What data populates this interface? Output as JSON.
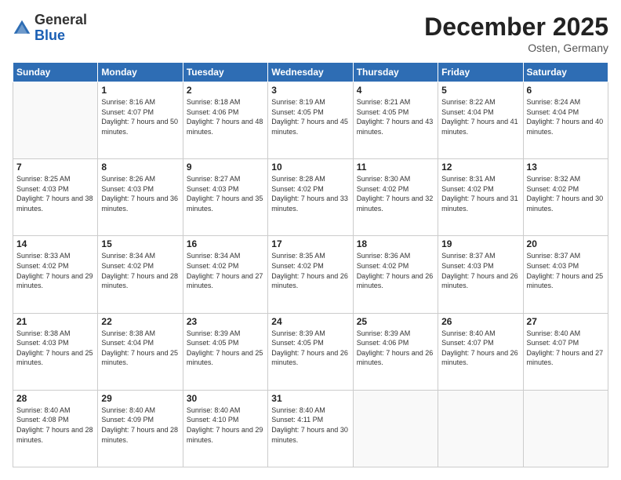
{
  "logo": {
    "general": "General",
    "blue": "Blue"
  },
  "title": "December 2025",
  "location": "Osten, Germany",
  "headers": [
    "Sunday",
    "Monday",
    "Tuesday",
    "Wednesday",
    "Thursday",
    "Friday",
    "Saturday"
  ],
  "weeks": [
    [
      {
        "day": "",
        "sunrise": "",
        "sunset": "",
        "daylight": ""
      },
      {
        "day": "1",
        "sunrise": "Sunrise: 8:16 AM",
        "sunset": "Sunset: 4:07 PM",
        "daylight": "Daylight: 7 hours and 50 minutes."
      },
      {
        "day": "2",
        "sunrise": "Sunrise: 8:18 AM",
        "sunset": "Sunset: 4:06 PM",
        "daylight": "Daylight: 7 hours and 48 minutes."
      },
      {
        "day": "3",
        "sunrise": "Sunrise: 8:19 AM",
        "sunset": "Sunset: 4:05 PM",
        "daylight": "Daylight: 7 hours and 45 minutes."
      },
      {
        "day": "4",
        "sunrise": "Sunrise: 8:21 AM",
        "sunset": "Sunset: 4:05 PM",
        "daylight": "Daylight: 7 hours and 43 minutes."
      },
      {
        "day": "5",
        "sunrise": "Sunrise: 8:22 AM",
        "sunset": "Sunset: 4:04 PM",
        "daylight": "Daylight: 7 hours and 41 minutes."
      },
      {
        "day": "6",
        "sunrise": "Sunrise: 8:24 AM",
        "sunset": "Sunset: 4:04 PM",
        "daylight": "Daylight: 7 hours and 40 minutes."
      }
    ],
    [
      {
        "day": "7",
        "sunrise": "Sunrise: 8:25 AM",
        "sunset": "Sunset: 4:03 PM",
        "daylight": "Daylight: 7 hours and 38 minutes."
      },
      {
        "day": "8",
        "sunrise": "Sunrise: 8:26 AM",
        "sunset": "Sunset: 4:03 PM",
        "daylight": "Daylight: 7 hours and 36 minutes."
      },
      {
        "day": "9",
        "sunrise": "Sunrise: 8:27 AM",
        "sunset": "Sunset: 4:03 PM",
        "daylight": "Daylight: 7 hours and 35 minutes."
      },
      {
        "day": "10",
        "sunrise": "Sunrise: 8:28 AM",
        "sunset": "Sunset: 4:02 PM",
        "daylight": "Daylight: 7 hours and 33 minutes."
      },
      {
        "day": "11",
        "sunrise": "Sunrise: 8:30 AM",
        "sunset": "Sunset: 4:02 PM",
        "daylight": "Daylight: 7 hours and 32 minutes."
      },
      {
        "day": "12",
        "sunrise": "Sunrise: 8:31 AM",
        "sunset": "Sunset: 4:02 PM",
        "daylight": "Daylight: 7 hours and 31 minutes."
      },
      {
        "day": "13",
        "sunrise": "Sunrise: 8:32 AM",
        "sunset": "Sunset: 4:02 PM",
        "daylight": "Daylight: 7 hours and 30 minutes."
      }
    ],
    [
      {
        "day": "14",
        "sunrise": "Sunrise: 8:33 AM",
        "sunset": "Sunset: 4:02 PM",
        "daylight": "Daylight: 7 hours and 29 minutes."
      },
      {
        "day": "15",
        "sunrise": "Sunrise: 8:34 AM",
        "sunset": "Sunset: 4:02 PM",
        "daylight": "Daylight: 7 hours and 28 minutes."
      },
      {
        "day": "16",
        "sunrise": "Sunrise: 8:34 AM",
        "sunset": "Sunset: 4:02 PM",
        "daylight": "Daylight: 7 hours and 27 minutes."
      },
      {
        "day": "17",
        "sunrise": "Sunrise: 8:35 AM",
        "sunset": "Sunset: 4:02 PM",
        "daylight": "Daylight: 7 hours and 26 minutes."
      },
      {
        "day": "18",
        "sunrise": "Sunrise: 8:36 AM",
        "sunset": "Sunset: 4:02 PM",
        "daylight": "Daylight: 7 hours and 26 minutes."
      },
      {
        "day": "19",
        "sunrise": "Sunrise: 8:37 AM",
        "sunset": "Sunset: 4:03 PM",
        "daylight": "Daylight: 7 hours and 26 minutes."
      },
      {
        "day": "20",
        "sunrise": "Sunrise: 8:37 AM",
        "sunset": "Sunset: 4:03 PM",
        "daylight": "Daylight: 7 hours and 25 minutes."
      }
    ],
    [
      {
        "day": "21",
        "sunrise": "Sunrise: 8:38 AM",
        "sunset": "Sunset: 4:03 PM",
        "daylight": "Daylight: 7 hours and 25 minutes."
      },
      {
        "day": "22",
        "sunrise": "Sunrise: 8:38 AM",
        "sunset": "Sunset: 4:04 PM",
        "daylight": "Daylight: 7 hours and 25 minutes."
      },
      {
        "day": "23",
        "sunrise": "Sunrise: 8:39 AM",
        "sunset": "Sunset: 4:05 PM",
        "daylight": "Daylight: 7 hours and 25 minutes."
      },
      {
        "day": "24",
        "sunrise": "Sunrise: 8:39 AM",
        "sunset": "Sunset: 4:05 PM",
        "daylight": "Daylight: 7 hours and 26 minutes."
      },
      {
        "day": "25",
        "sunrise": "Sunrise: 8:39 AM",
        "sunset": "Sunset: 4:06 PM",
        "daylight": "Daylight: 7 hours and 26 minutes."
      },
      {
        "day": "26",
        "sunrise": "Sunrise: 8:40 AM",
        "sunset": "Sunset: 4:07 PM",
        "daylight": "Daylight: 7 hours and 26 minutes."
      },
      {
        "day": "27",
        "sunrise": "Sunrise: 8:40 AM",
        "sunset": "Sunset: 4:07 PM",
        "daylight": "Daylight: 7 hours and 27 minutes."
      }
    ],
    [
      {
        "day": "28",
        "sunrise": "Sunrise: 8:40 AM",
        "sunset": "Sunset: 4:08 PM",
        "daylight": "Daylight: 7 hours and 28 minutes."
      },
      {
        "day": "29",
        "sunrise": "Sunrise: 8:40 AM",
        "sunset": "Sunset: 4:09 PM",
        "daylight": "Daylight: 7 hours and 28 minutes."
      },
      {
        "day": "30",
        "sunrise": "Sunrise: 8:40 AM",
        "sunset": "Sunset: 4:10 PM",
        "daylight": "Daylight: 7 hours and 29 minutes."
      },
      {
        "day": "31",
        "sunrise": "Sunrise: 8:40 AM",
        "sunset": "Sunset: 4:11 PM",
        "daylight": "Daylight: 7 hours and 30 minutes."
      },
      {
        "day": "",
        "sunrise": "",
        "sunset": "",
        "daylight": ""
      },
      {
        "day": "",
        "sunrise": "",
        "sunset": "",
        "daylight": ""
      },
      {
        "day": "",
        "sunrise": "",
        "sunset": "",
        "daylight": ""
      }
    ]
  ]
}
